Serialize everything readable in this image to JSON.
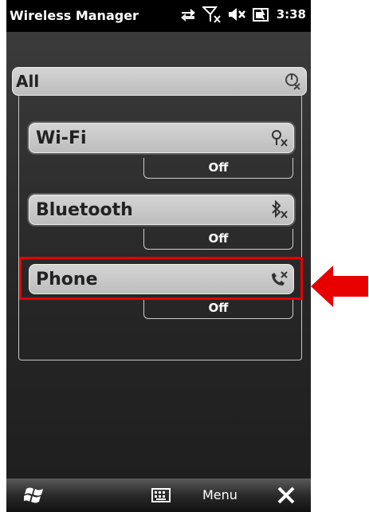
{
  "statusbar": {
    "title": "Wireless Manager",
    "time": "3:38",
    "icons": [
      "data-sync-icon",
      "no-signal-icon",
      "speaker-muted-icon",
      "battery-charging-icon"
    ]
  },
  "all": {
    "label": "All",
    "icon": "all-radios-off-icon"
  },
  "devices": [
    {
      "label": "Wi-Fi",
      "status": "Off",
      "icon": "wifi-off-icon"
    },
    {
      "label": "Bluetooth",
      "status": "Off",
      "icon": "bluetooth-off-icon"
    },
    {
      "label": "Phone",
      "status": "Off",
      "icon": "phone-off-icon"
    }
  ],
  "softkeys": {
    "menu_label": "Menu",
    "left_icon": "windows-start-icon",
    "center_icon": "keyboard-icon",
    "right_icon": "close-icon"
  },
  "annotation": {
    "color": "#e60000",
    "target": "Phone"
  }
}
